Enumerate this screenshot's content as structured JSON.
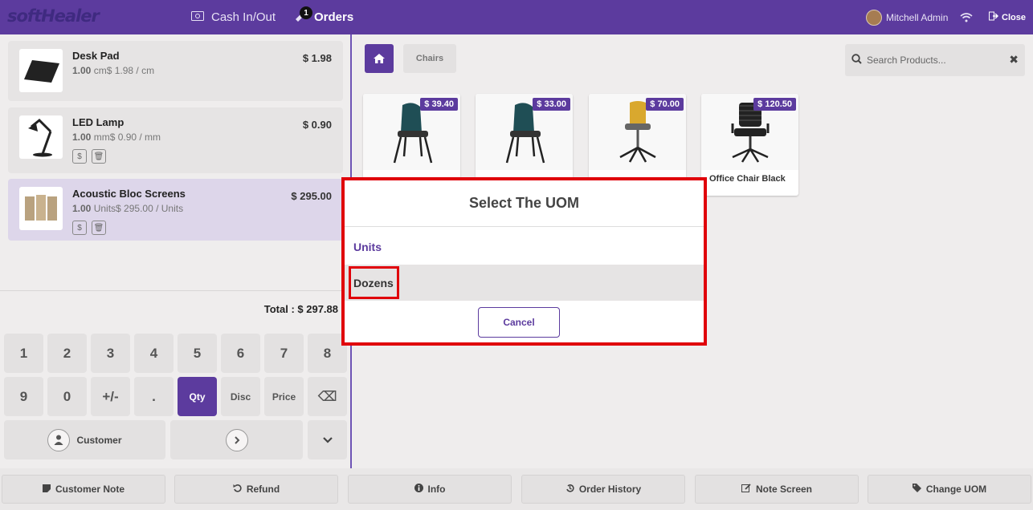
{
  "header": {
    "logo": "softHealer",
    "cash_label": "Cash In/Out",
    "orders_label": "Orders",
    "orders_badge": "1",
    "user_name": "Mitchell Admin",
    "close_label": "Close"
  },
  "orderlines": [
    {
      "name": "Desk Pad",
      "qty": "1.00",
      "detail": "cm$ 1.98 / cm",
      "price": "$ 1.98"
    },
    {
      "name": "LED Lamp",
      "qty": "1.00",
      "detail": "mm$ 0.90 / mm",
      "price": "$ 0.90"
    },
    {
      "name": "Acoustic Bloc Screens",
      "qty": "1.00",
      "detail": "Units$ 295.00 / Units",
      "price": "$ 295.00"
    }
  ],
  "line_buttons": {
    "price": "$",
    "delete": "🗑"
  },
  "total": "Total : $ 297.88",
  "numpad": {
    "row1": [
      "1",
      "2",
      "3",
      "4",
      "5",
      "6",
      "7",
      "8"
    ],
    "row2": [
      "9",
      "0",
      "+/-",
      ".",
      "Qty",
      "Disc",
      "Price",
      "⌫"
    ],
    "customer": "Customer"
  },
  "products": {
    "category": "Chairs",
    "search_placeholder": "Search Products...",
    "cards": [
      {
        "price": "$ 39.40",
        "name": ""
      },
      {
        "price": "$ 33.00",
        "name": ""
      },
      {
        "price": "$ 70.00",
        "name": ""
      },
      {
        "price": "$ 120.50",
        "name": "Office Chair Black"
      }
    ]
  },
  "bottom": {
    "customer_note": "Customer Note",
    "refund": "Refund",
    "info": "Info",
    "order_history": "Order History",
    "note_screen": "Note Screen",
    "change_uom": "Change UOM"
  },
  "modal": {
    "title": "Select The UOM",
    "options": [
      "Units",
      "Dozens"
    ],
    "cancel": "Cancel"
  },
  "colors": {
    "brand": "#5c3b9e",
    "highlight": "#e0000a"
  }
}
